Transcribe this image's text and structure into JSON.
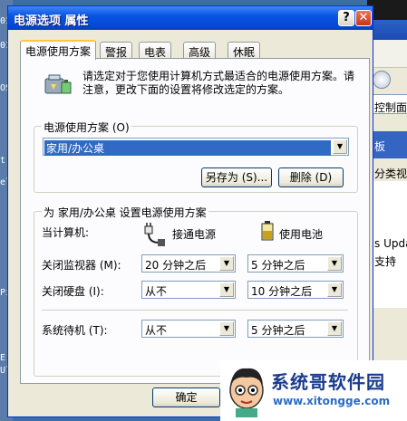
{
  "window": {
    "title": "电源选项 属性",
    "help_glyph": "?",
    "close_glyph": "✕"
  },
  "tabs": [
    {
      "label": "电源使用方案"
    },
    {
      "label": "警报"
    },
    {
      "label": "电表"
    },
    {
      "label": "高级"
    },
    {
      "label": "休眠"
    }
  ],
  "intro_text": "请选定对于您使用计算机方式最适合的电源使用方案。请注意，更改下面的设置将修改选定的方案。",
  "scheme_group": {
    "title": "电源使用方案 (O)",
    "selected": "家用/办公桌",
    "save_as_label": "另存为 (S)...",
    "delete_label": "删除 (D)"
  },
  "settings_group": {
    "title": "为 家用/办公桌 设置电源使用方案",
    "computer_label": "当计算机:",
    "ac_label": "接通电源",
    "battery_label": "使用电池",
    "rows": [
      {
        "label": "关闭监视器 (M):",
        "ac": "20 分钟之后",
        "dc": "5 分钟之后"
      },
      {
        "label": "关闭硬盘 (I):",
        "ac": "从不",
        "dc": "10 分钟之后"
      },
      {
        "label": "系统待机 (T):",
        "ac": "从不",
        "dc": "5 分钟之后"
      }
    ]
  },
  "footer": {
    "ok_label": "确定"
  },
  "background": {
    "left_fragments": [
      "01",
      "01",
      "OS",
      "t",
      "el",
      "Pi",
      "E",
      "Ul"
    ],
    "right_fragments": [
      "控制面板",
      "板",
      "分类视图",
      "s Updat",
      "支持"
    ]
  },
  "watermark": {
    "title": "系统哥软件园",
    "url": "www.xitongge.com"
  }
}
